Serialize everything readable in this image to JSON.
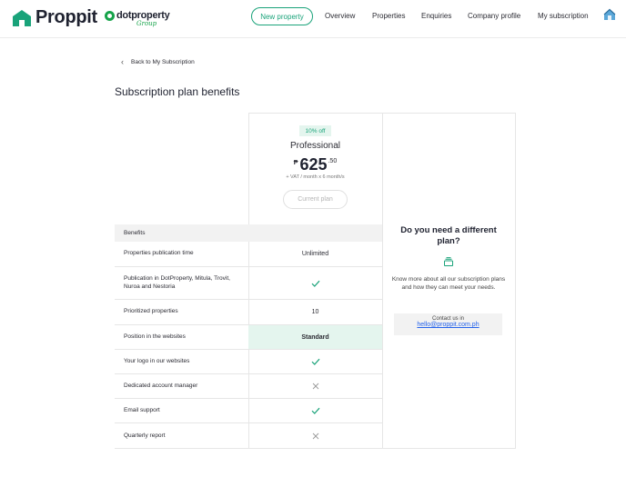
{
  "header": {
    "brand": "Proppit",
    "partner_brand": "dotproperty",
    "partner_sub": "Group",
    "new_property_label": "New property",
    "nav": [
      "Overview",
      "Properties",
      "Enquiries",
      "Company profile",
      "My subscription"
    ],
    "accent_color": "#1aa37a"
  },
  "back_link": "Back to My Subscription",
  "page_title": "Subscription plan benefits",
  "plan": {
    "discount_badge": "10% off",
    "name": "Professional",
    "currency_symbol": "₱",
    "price_whole": "625",
    "price_decimal": ".50",
    "vat_note": "+ VAT / month x 6 month/s",
    "current_plan_label": "Current plan"
  },
  "benefits_header": "Benefits",
  "benefits": [
    {
      "label": "Properties publication time",
      "value": "Unlimited",
      "kind": "text"
    },
    {
      "label": "Publication in DotProperty, Mitula, Trovit, Nuroa and Nestoria",
      "value": "",
      "kind": "check"
    },
    {
      "label": "Prioritized properties",
      "value": "10",
      "kind": "text"
    },
    {
      "label": "Position in the websites",
      "value": "Standard",
      "kind": "highlight"
    },
    {
      "label": "Your logo in our websites",
      "value": "",
      "kind": "check"
    },
    {
      "label": "Dedicated account manager",
      "value": "",
      "kind": "cross"
    },
    {
      "label": "Email support",
      "value": "",
      "kind": "check"
    },
    {
      "label": "Quarterly report",
      "value": "",
      "kind": "cross"
    }
  ],
  "side_panel": {
    "title": "Do you need a different plan?",
    "text": "Know more about all our subscription plans and how they can meet your needs.",
    "contact_label": "Contact us in",
    "contact_email": "hello@proppit.com.ph"
  }
}
